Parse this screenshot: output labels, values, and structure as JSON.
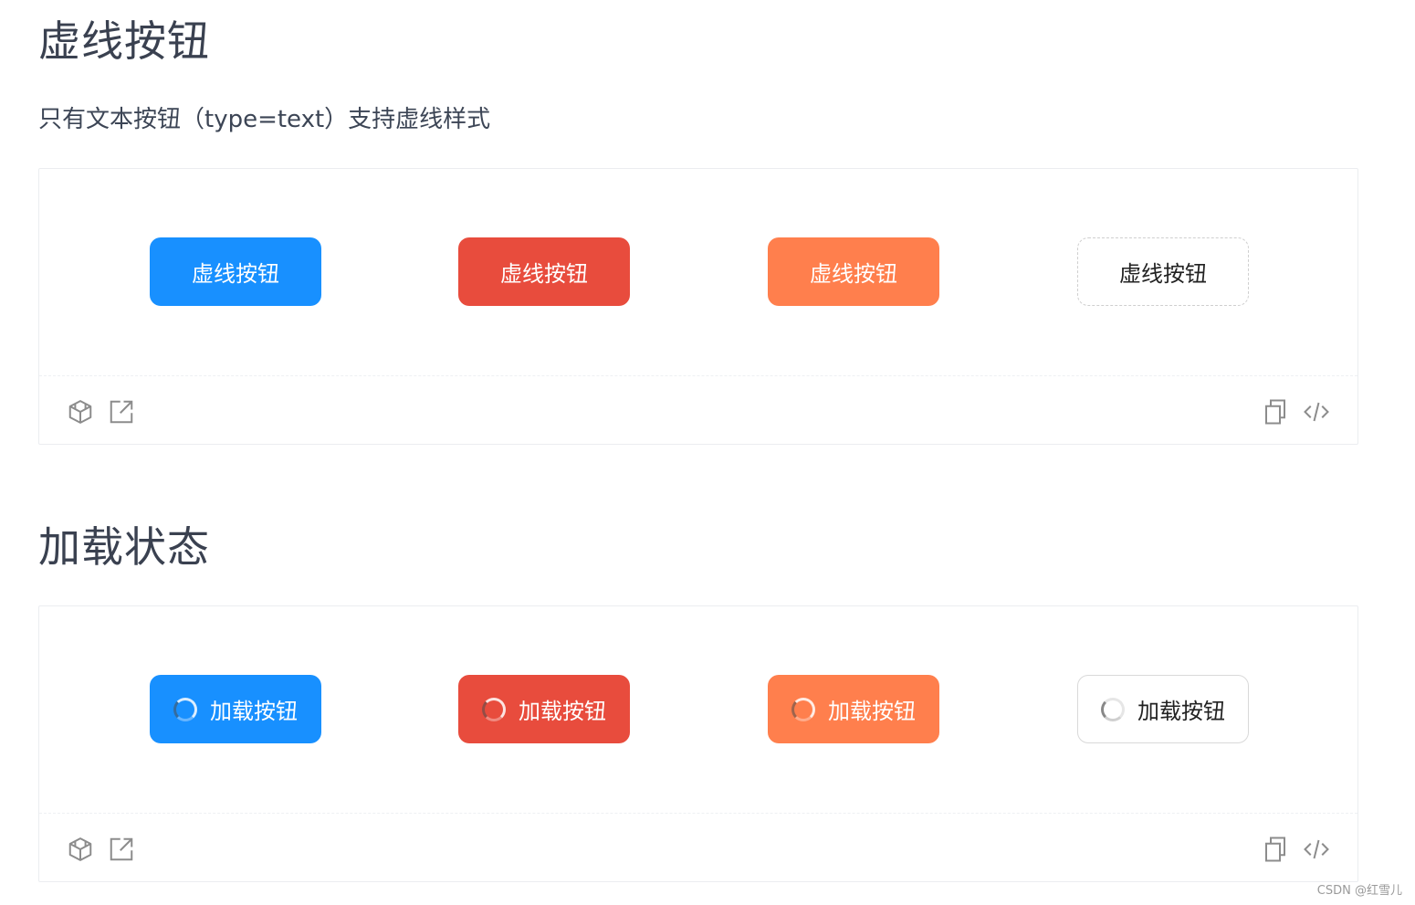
{
  "sections": [
    {
      "title": "虚线按钮",
      "description": "只有文本按钮（type=text）支持虚线样式",
      "buttons": [
        {
          "label": "虚线按钮",
          "variant": "primary",
          "color": "#1890ff"
        },
        {
          "label": "虚线按钮",
          "variant": "danger",
          "color": "#e84c3d"
        },
        {
          "label": "虚线按钮",
          "variant": "warning",
          "color": "#ff7f4d"
        },
        {
          "label": "虚线按钮",
          "variant": "default-dashed",
          "color": "#ffffff"
        }
      ],
      "toolbar_icons": [
        "codesandbox-icon",
        "external-link-icon",
        "copy-icon",
        "code-icon"
      ]
    },
    {
      "title": "加载状态",
      "buttons": [
        {
          "label": "加载按钮",
          "variant": "primary",
          "loading": true
        },
        {
          "label": "加载按钮",
          "variant": "danger",
          "loading": true
        },
        {
          "label": "加载按钮",
          "variant": "warning",
          "loading": true
        },
        {
          "label": "加载按钮",
          "variant": "default",
          "loading": true
        }
      ],
      "toolbar_icons": [
        "codesandbox-icon",
        "external-link-icon",
        "copy-icon",
        "code-icon"
      ]
    }
  ],
  "watermark": "CSDN @红雪儿"
}
